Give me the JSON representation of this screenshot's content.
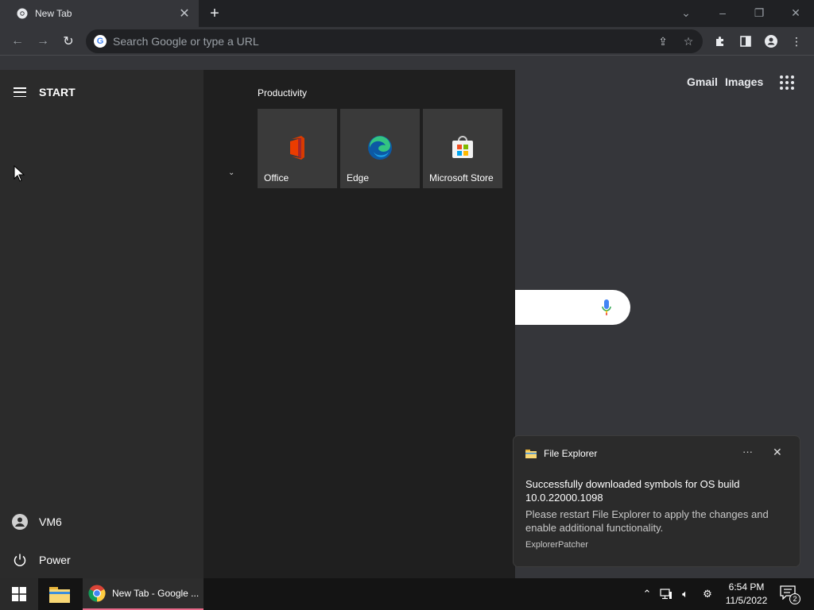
{
  "browser": {
    "tab": {
      "title": "New Tab"
    },
    "omnibox": {
      "placeholder": "Search Google or type a URL"
    },
    "accent_color": "#35363a"
  },
  "ntp": {
    "links": {
      "gmail": "Gmail",
      "images": "Images"
    }
  },
  "start_menu": {
    "title": "START",
    "group_title": "Productivity",
    "tiles": [
      {
        "label": "Office",
        "icon": "office-icon"
      },
      {
        "label": "Edge",
        "icon": "edge-icon"
      },
      {
        "label": "Microsoft Store",
        "icon": "store-icon"
      }
    ],
    "user": {
      "name": "VM6"
    },
    "power": {
      "label": "Power"
    }
  },
  "toast": {
    "app": "File Explorer",
    "title": "Successfully downloaded symbols for OS build 10.0.22000.1098",
    "body": "Please restart File Explorer to apply the changes and enable additional functionality.",
    "attribution": "ExplorerPatcher"
  },
  "taskbar": {
    "chrome_label": "New Tab - Google ...",
    "time": "6:54 PM",
    "date": "11/5/2022",
    "notification_count": "2"
  }
}
